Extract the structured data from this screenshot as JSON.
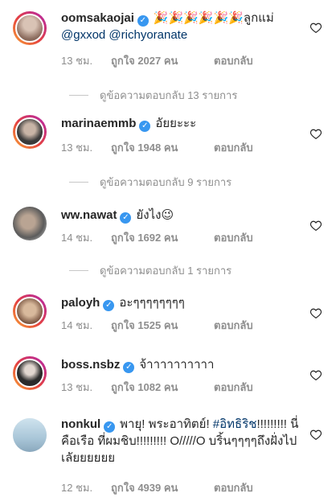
{
  "comments": [
    {
      "username": "oomsakaojai",
      "verified": true,
      "text_parts": [
        "🎉🎉🎉🎉🎉🎉ลูกแม่",
        "@gxxod @richyoranate"
      ],
      "time": "13 ชม.",
      "likes": "ถูกใจ 2027 คน",
      "reply": "ตอบกลับ",
      "view_replies": "ดูข้อความตอบกลับ 13 รายการ",
      "avatar_colors": [
        "#d9c3b5",
        "#8b6b5d"
      ]
    },
    {
      "username": "marinaemmb",
      "verified": true,
      "text": "อัยยะะะ",
      "time": "13 ชม.",
      "likes": "ถูกใจ 1948 คน",
      "reply": "ตอบกลับ",
      "view_replies": "ดูข้อความตอบกลับ 9 รายการ",
      "avatar_colors": [
        "#3a3a3a",
        "#c8b4a6"
      ]
    },
    {
      "username": "ww.nawat",
      "verified": true,
      "text": "ยังไง😉",
      "time": "14 ชม.",
      "likes": "ถูกใจ 1692 คน",
      "reply": "ตอบกลับ",
      "view_replies": "ดูข้อความตอบกลับ 1 รายการ",
      "avatar_colors": [
        "#5b5b5b",
        "#b9a493"
      ]
    },
    {
      "username": "paloyh",
      "verified": true,
      "text": "อะๆๆๆๆๆๆๆๆ",
      "time": "14 ชม.",
      "likes": "ถูกใจ 1525 คน",
      "reply": "ตอบกลับ",
      "avatar_colors": [
        "#d8b99c",
        "#7a5642"
      ]
    },
    {
      "username": "boss.nsbz",
      "verified": true,
      "text": "จ้าาาาาาาาาา",
      "time": "13 ชม.",
      "likes": "ถูกใจ 1082 คน",
      "reply": "ตอบกลับ",
      "avatar_colors": [
        "#2b2b2b",
        "#e1d6cf"
      ]
    },
    {
      "username": "nonkul",
      "verified": true,
      "text_a": "พายุ! พระอาทิตย์!",
      "hashtag": "#อิทธิริช",
      "text_b": "!!!!!!!!! นี่คือเรือ ที่ผมชิบ!!!!!!!!! O/////O บริ้นๆๆๆๆถึงฝั่งไปเลัยยยยยย",
      "time": "12 ชม.",
      "likes": "ถูกใจ 4939 คน",
      "reply": "ตอบกลับ",
      "avatar_colors": [
        "#cfe3ee",
        "#8aa8bd"
      ]
    }
  ],
  "accent_colors": {
    "link": "#003569",
    "verified": "#3897f0",
    "meta": "#8e8e8e"
  }
}
